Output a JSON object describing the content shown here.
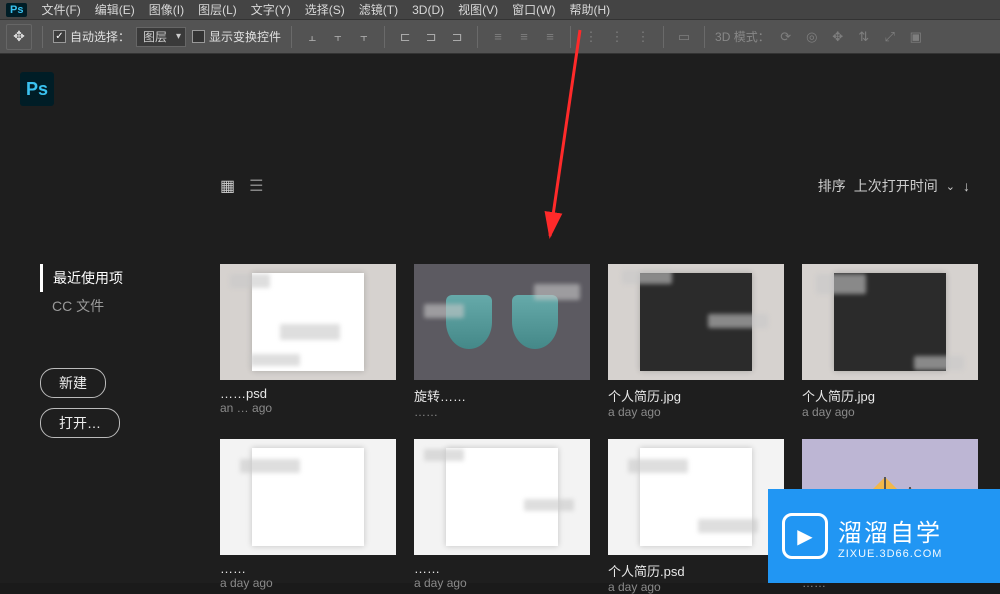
{
  "app": {
    "badge": "Ps"
  },
  "menus": [
    "文件(F)",
    "编辑(E)",
    "图像(I)",
    "图层(L)",
    "文字(Y)",
    "选择(S)",
    "滤镜(T)",
    "3D(D)",
    "视图(V)",
    "窗口(W)",
    "帮助(H)"
  ],
  "options": {
    "auto_select": "自动选择：",
    "layer_select": "图层",
    "show_transform": "显示变换控件",
    "mode3d": "3D 模式："
  },
  "home": {
    "sort_label": "排序",
    "sort_value": "上次打开时间",
    "nav": {
      "recent": "最近使用项",
      "cc": "CC 文件"
    },
    "buttons": {
      "new": "新建",
      "open": "打开…"
    }
  },
  "cards": [
    {
      "title": "……psd",
      "time": "an … ago",
      "style": "light-doodle"
    },
    {
      "title": "旋转……",
      "time": "……",
      "style": "cylinders"
    },
    {
      "title": "个人简历.jpg",
      "time": "a day ago",
      "style": "resume-dark"
    },
    {
      "title": "个人简历.jpg",
      "time": "a day ago",
      "style": "resume-dark2"
    },
    {
      "title": "……",
      "time": "a day ago",
      "style": "resume-doc"
    },
    {
      "title": "……",
      "time": "a day ago",
      "style": "resume-doc2"
    },
    {
      "title": "个人简历.psd",
      "time": "a day ago",
      "style": "resume-photo"
    },
    {
      "title": "……",
      "time": "……",
      "style": "umbrella"
    }
  ],
  "watermark": {
    "zh": "溜溜自学",
    "en": "ZIXUE.3D66.COM"
  }
}
